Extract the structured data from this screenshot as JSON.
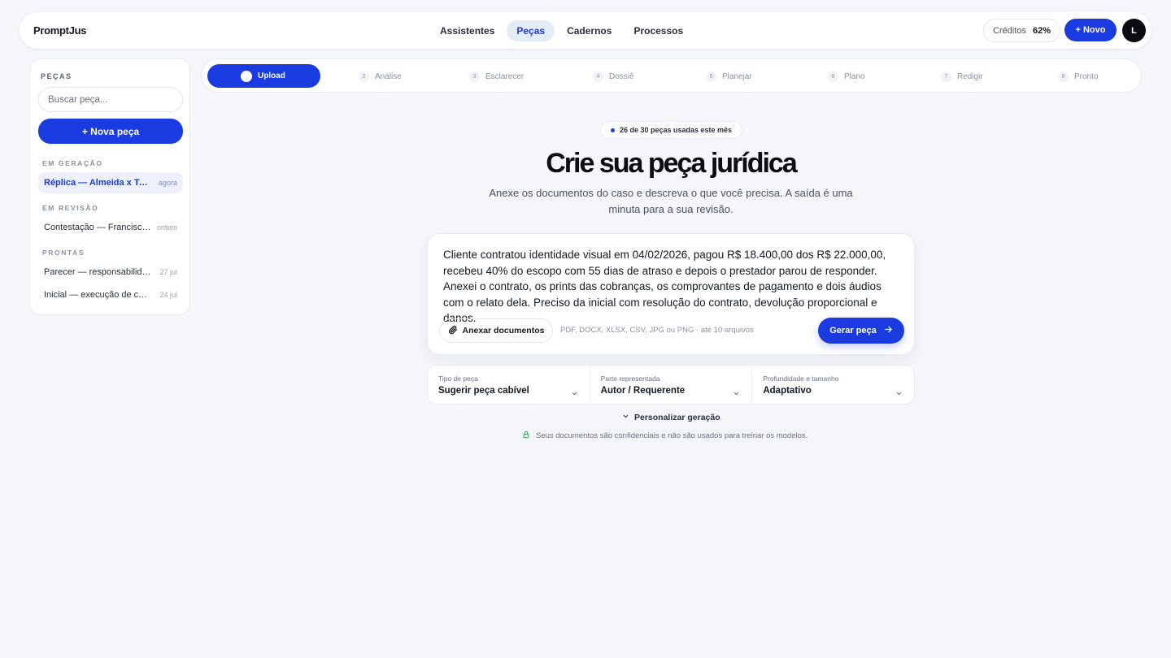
{
  "header": {
    "brand": "PromptJus",
    "nav": [
      {
        "label": "Assistentes",
        "active": false
      },
      {
        "label": "Peças",
        "active": true
      },
      {
        "label": "Cadernos",
        "active": false
      },
      {
        "label": "Processos",
        "active": false
      }
    ],
    "credits_label": "Créditos",
    "credits_value": "62%",
    "new_button": "+ Novo",
    "avatar_initial": "L"
  },
  "sidebar": {
    "title": "PEÇAS",
    "search_placeholder": "Buscar peça...",
    "new_button": "+ Nova peça",
    "sections": [
      {
        "title": "EM GERAÇÃO",
        "items": [
          {
            "label": "Réplica — Almeida x Telecom",
            "time": "agora",
            "active": true
          }
        ]
      },
      {
        "title": "EM REVISÃO",
        "items": [
          {
            "label": "Contestação — Francisco Souza",
            "time": "ontem",
            "active": false
          }
        ]
      },
      {
        "title": "PRONTAS",
        "items": [
          {
            "label": "Parecer — responsabilidade civil",
            "time": "27 jul",
            "active": false
          },
          {
            "label": "Inicial — execução de cheque",
            "time": "24 jul",
            "active": false
          }
        ]
      }
    ]
  },
  "stepper": {
    "active": {
      "label": "Upload"
    },
    "steps": [
      {
        "num": "2",
        "label": "Análise"
      },
      {
        "num": "3",
        "label": "Esclarecer"
      },
      {
        "num": "4",
        "label": "Dossiê"
      },
      {
        "num": "5",
        "label": "Planejar"
      },
      {
        "num": "6",
        "label": "Plano"
      },
      {
        "num": "7",
        "label": "Redigir"
      },
      {
        "num": "8",
        "label": "Pronto"
      }
    ]
  },
  "main": {
    "usage_badge": "26 de 30 peças usadas este mês",
    "title": "Crie sua peça jurídica",
    "subtitle": "Anexe os documentos do caso e descreva o que você precisa. A saída é uma minuta para a sua revisão.",
    "composer_text": "Cliente contratou identidade visual em 04/02/2026, pagou R$ 18.400,00 dos R$ 22.000,00, recebeu 40% do escopo com 55 dias de atraso e depois o prestador parou de responder. Anexei o contrato, os prints das cobranças, os comprovantes de pagamento e dois áudios com o relato dela. Preciso da inicial com resolução do contrato, devolução proporcional e danos.",
    "attach_label": "Anexar documentos",
    "attach_hint": "PDF, DOCX, XLSX, CSV, JPG ou PNG · até 10 arquivos",
    "generate_label": "Gerar peça",
    "selects": [
      {
        "caption": "Tipo de peça",
        "value": "Sugerir peça cabível"
      },
      {
        "caption": "Parte representada",
        "value": "Autor / Requerente"
      },
      {
        "caption": "Profundidade e tamanho",
        "value": "Adaptativo"
      }
    ],
    "personalize_label": "Personalizar geração",
    "privacy_note": "Seus documentos são confidenciais e não são usados para treinar os modelos."
  },
  "colors": {
    "accent": "#1a3be0",
    "background": "#f4f6fa",
    "privacy_lock": "#2f9e5a"
  },
  "icons": [
    "paperclip-icon",
    "arrow-right-icon",
    "chevron-down-icon",
    "lock-icon"
  ]
}
